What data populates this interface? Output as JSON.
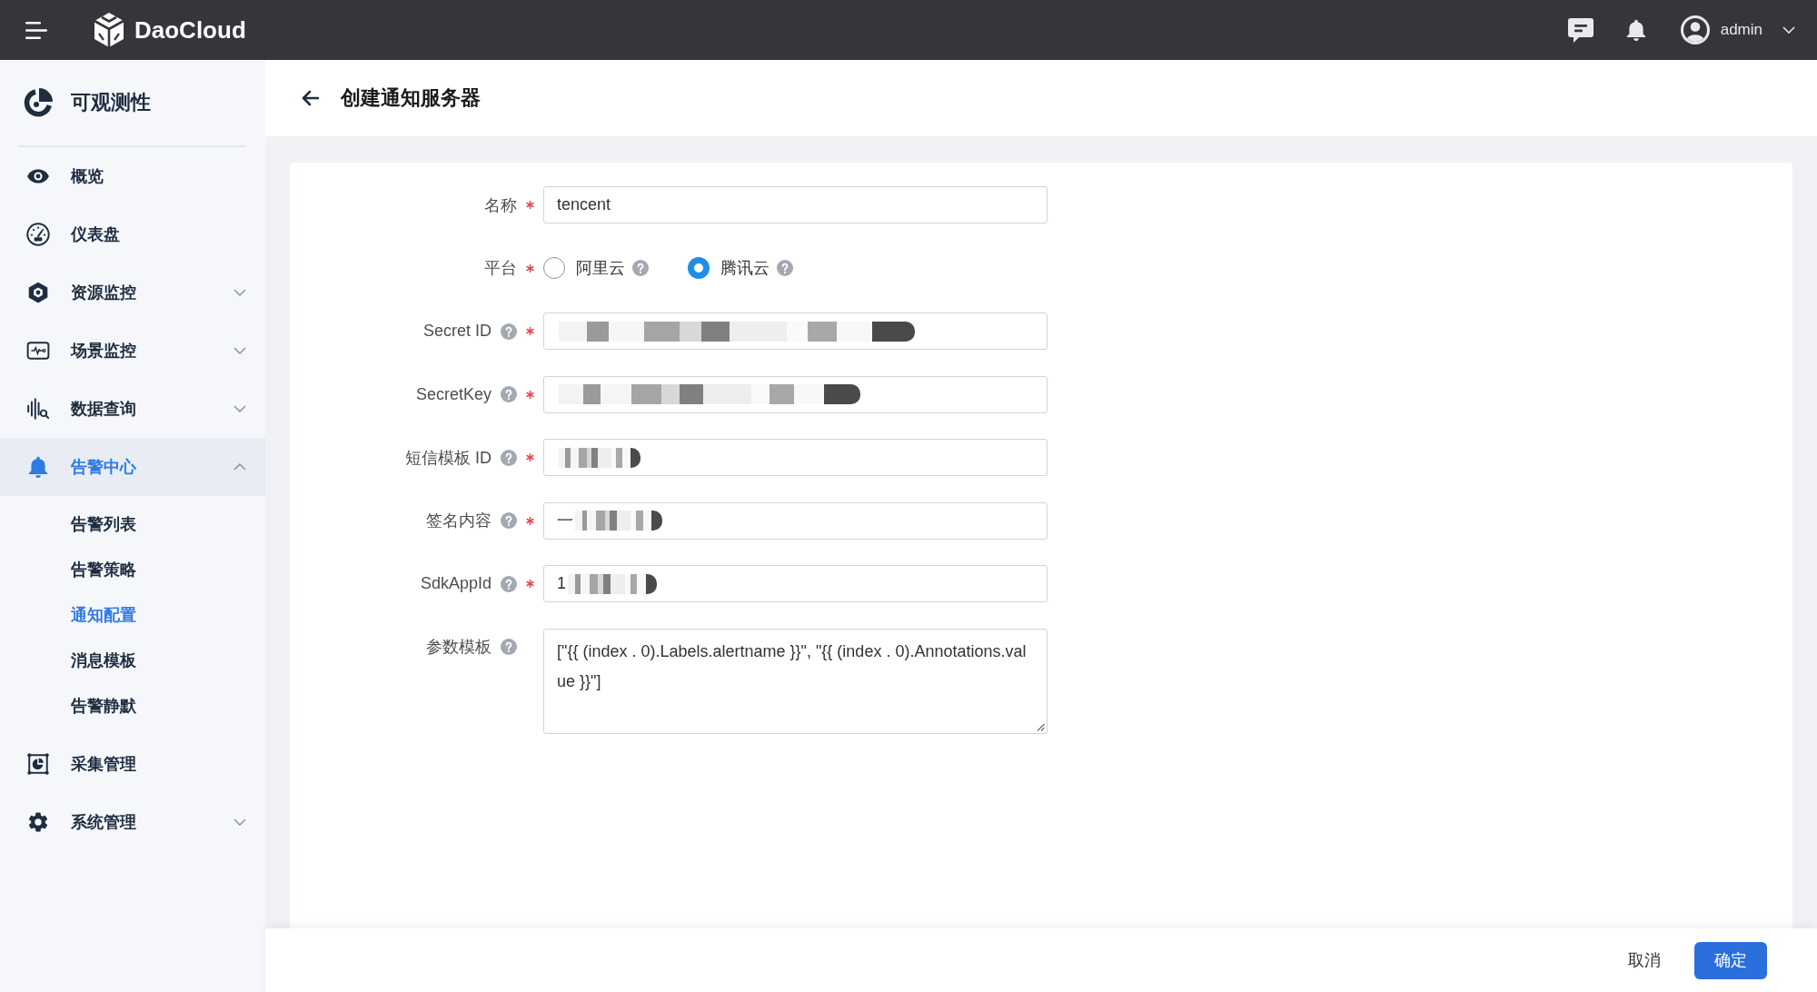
{
  "topbar": {
    "brand": "DaoCloud",
    "user": "admin"
  },
  "sidebar": {
    "title": "可观测性",
    "items": [
      {
        "label": "概览",
        "kind": "link",
        "selected": false
      },
      {
        "label": "仪表盘",
        "kind": "link",
        "selected": false
      },
      {
        "label": "资源监控",
        "kind": "group",
        "selected": false,
        "expanded": false
      },
      {
        "label": "场景监控",
        "kind": "group",
        "selected": false,
        "expanded": false
      },
      {
        "label": "数据查询",
        "kind": "group",
        "selected": false,
        "expanded": false
      },
      {
        "label": "告警中心",
        "kind": "group",
        "selected": true,
        "expanded": true,
        "children": [
          {
            "label": "告警列表",
            "selected": false
          },
          {
            "label": "告警策略",
            "selected": false
          },
          {
            "label": "通知配置",
            "selected": true
          },
          {
            "label": "消息模板",
            "selected": false
          },
          {
            "label": "告警静默",
            "selected": false
          }
        ]
      },
      {
        "label": "采集管理",
        "kind": "link",
        "selected": false
      },
      {
        "label": "系统管理",
        "kind": "group",
        "selected": false,
        "expanded": false
      }
    ]
  },
  "page_header": {
    "title": "创建通知服务器"
  },
  "form": {
    "fields": [
      {
        "kind": "text",
        "label": "名称",
        "required": true,
        "help": false,
        "value": "tencent"
      },
      {
        "kind": "radio",
        "label": "平台",
        "required": true,
        "help": false,
        "options": [
          {
            "label": "阿里云",
            "selected": false,
            "help": true
          },
          {
            "label": "腾讯云",
            "selected": true,
            "help": true
          }
        ]
      },
      {
        "kind": "text",
        "label": "Secret ID",
        "required": true,
        "help": true,
        "redacted": true
      },
      {
        "kind": "text",
        "label": "SecretKey",
        "required": true,
        "help": true,
        "redacted": true
      },
      {
        "kind": "text",
        "label": "短信模板 ID",
        "required": true,
        "help": true,
        "redacted": true
      },
      {
        "kind": "text",
        "label": "签名内容",
        "required": true,
        "help": true,
        "value": "一",
        "redacted": true
      },
      {
        "kind": "text",
        "label": "SdkAppId",
        "required": true,
        "help": true,
        "value": "1",
        "redacted": true
      },
      {
        "kind": "textarea",
        "label": "参数模板",
        "required": false,
        "help": true,
        "value": "[\"{{ (index . 0).Labels.alertname }}\", \"{{ (index . 0).Annotations.value }}\"]"
      }
    ]
  },
  "footer": {
    "buttons": [
      {
        "label": "取消",
        "kind": "default"
      },
      {
        "label": "确定",
        "kind": "primary"
      }
    ]
  }
}
